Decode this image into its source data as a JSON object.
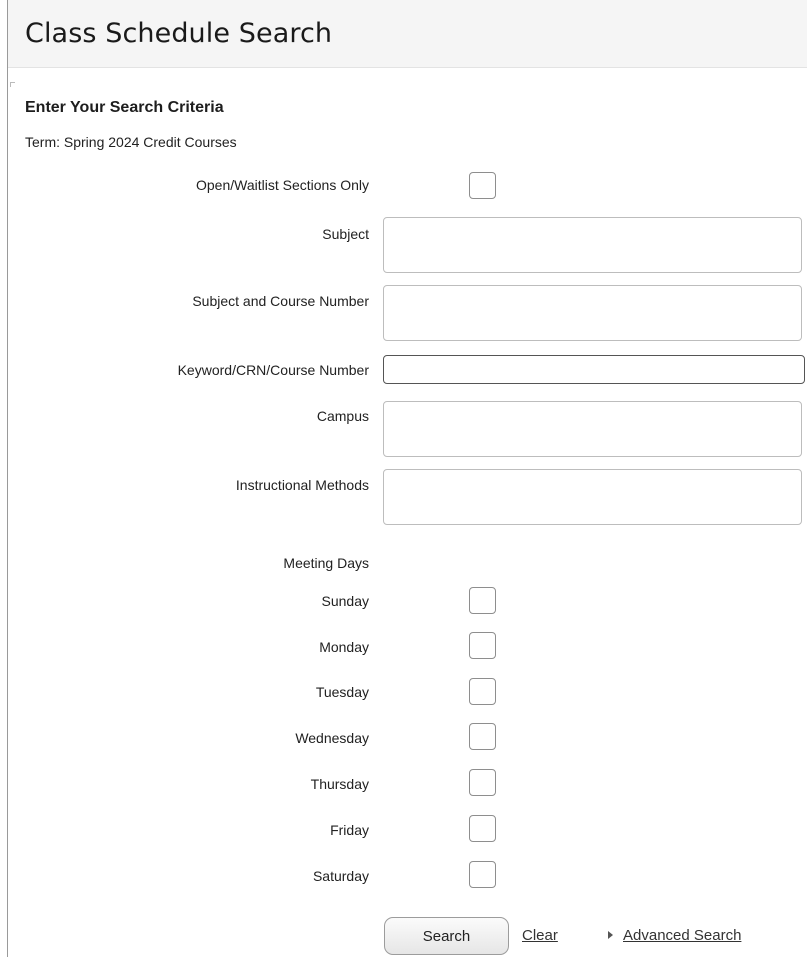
{
  "header": {
    "title": "Class Schedule Search"
  },
  "form": {
    "section_title": "Enter Your Search Criteria",
    "term": "Term: Spring 2024 Credit Courses",
    "open_waitlist_label": "Open/Waitlist Sections Only",
    "subject_label": "Subject",
    "subject_course_label": "Subject and Course Number",
    "keyword_label": "Keyword/CRN/Course Number",
    "keyword_value": "",
    "campus_label": "Campus",
    "instructional_methods_label": "Instructional Methods",
    "meeting_days_label": "Meeting Days",
    "days": [
      "Sunday",
      "Monday",
      "Tuesday",
      "Wednesday",
      "Thursday",
      "Friday",
      "Saturday"
    ]
  },
  "actions": {
    "search_label": "Search",
    "clear_label": "Clear",
    "advanced_label": "Advanced Search"
  }
}
